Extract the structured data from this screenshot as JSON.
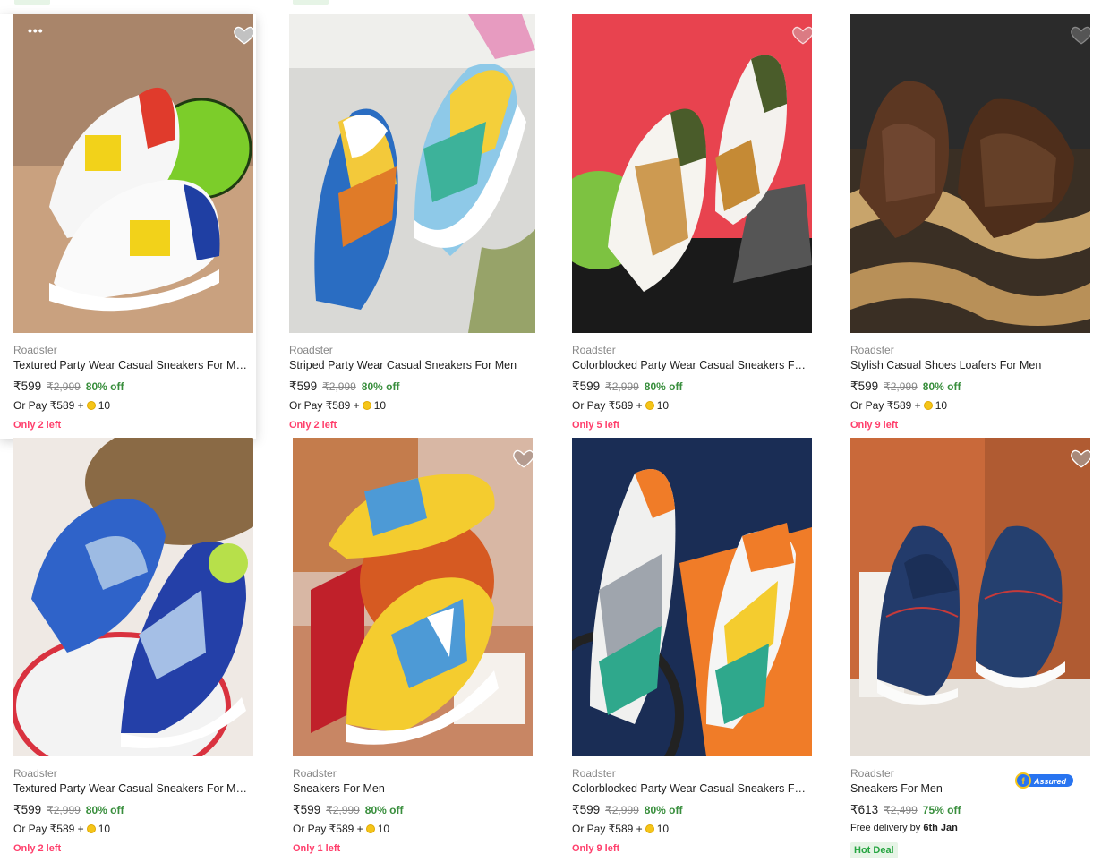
{
  "colors": {
    "price": "#212121",
    "mrp": "#878787",
    "discount": "#388e3c",
    "stock": "#ff3f6c",
    "hot_deal": "#26a541",
    "assured_blue": "#2874f0"
  },
  "products": [
    {
      "brand": "Roadster",
      "title": "Textured Party Wear Casual Sneakers For Men",
      "price": "₹599",
      "mrp": "₹2,999",
      "discount": "80% off",
      "pay_prefix": "Or Pay ₹589 +",
      "pay_coins": "10",
      "stock": "Only 2 left",
      "icon": "heart-icon"
    },
    {
      "brand": "Roadster",
      "title": "Striped Party Wear Casual Sneakers For Men",
      "price": "₹599",
      "mrp": "₹2,999",
      "discount": "80% off",
      "pay_prefix": "Or Pay ₹589 +",
      "pay_coins": "10",
      "stock": "Only 2 left"
    },
    {
      "brand": "Roadster",
      "title": "Colorblocked Party Wear Casual Sneakers For ...",
      "price": "₹599",
      "mrp": "₹2,999",
      "discount": "80% off",
      "pay_prefix": "Or Pay ₹589 +",
      "pay_coins": "10",
      "stock": "Only 5 left"
    },
    {
      "brand": "Roadster",
      "title": "Stylish Casual Shoes Loafers For Men",
      "price": "₹599",
      "mrp": "₹2,999",
      "discount": "80% off",
      "pay_prefix": "Or Pay ₹589 +",
      "pay_coins": "10",
      "stock": "Only 9 left"
    },
    {
      "brand": "Roadster",
      "title": "Textured Party Wear Casual Sneakers For Men",
      "price": "₹599",
      "mrp": "₹2,999",
      "discount": "80% off",
      "pay_prefix": "Or Pay ₹589 +",
      "pay_coins": "10",
      "stock": "Only 2 left"
    },
    {
      "brand": "Roadster",
      "title": "Sneakers For Men",
      "price": "₹599",
      "mrp": "₹2,999",
      "discount": "80% off",
      "pay_prefix": "Or Pay ₹589 +",
      "pay_coins": "10",
      "stock": "Only 1 left"
    },
    {
      "brand": "Roadster",
      "title": "Colorblocked Party Wear Casual Sneakers For ...",
      "price": "₹599",
      "mrp": "₹2,999",
      "discount": "80% off",
      "pay_prefix": "Or Pay ₹589 +",
      "pay_coins": "10",
      "stock": "Only 9 left"
    },
    {
      "brand": "Roadster",
      "title": "Sneakers For Men",
      "price": "₹613",
      "mrp": "₹2,499",
      "discount": "75% off",
      "delivery_prefix": "Free delivery by",
      "delivery_date": "6th Jan",
      "hot_deal": "Hot Deal",
      "assured": "Assured"
    }
  ]
}
